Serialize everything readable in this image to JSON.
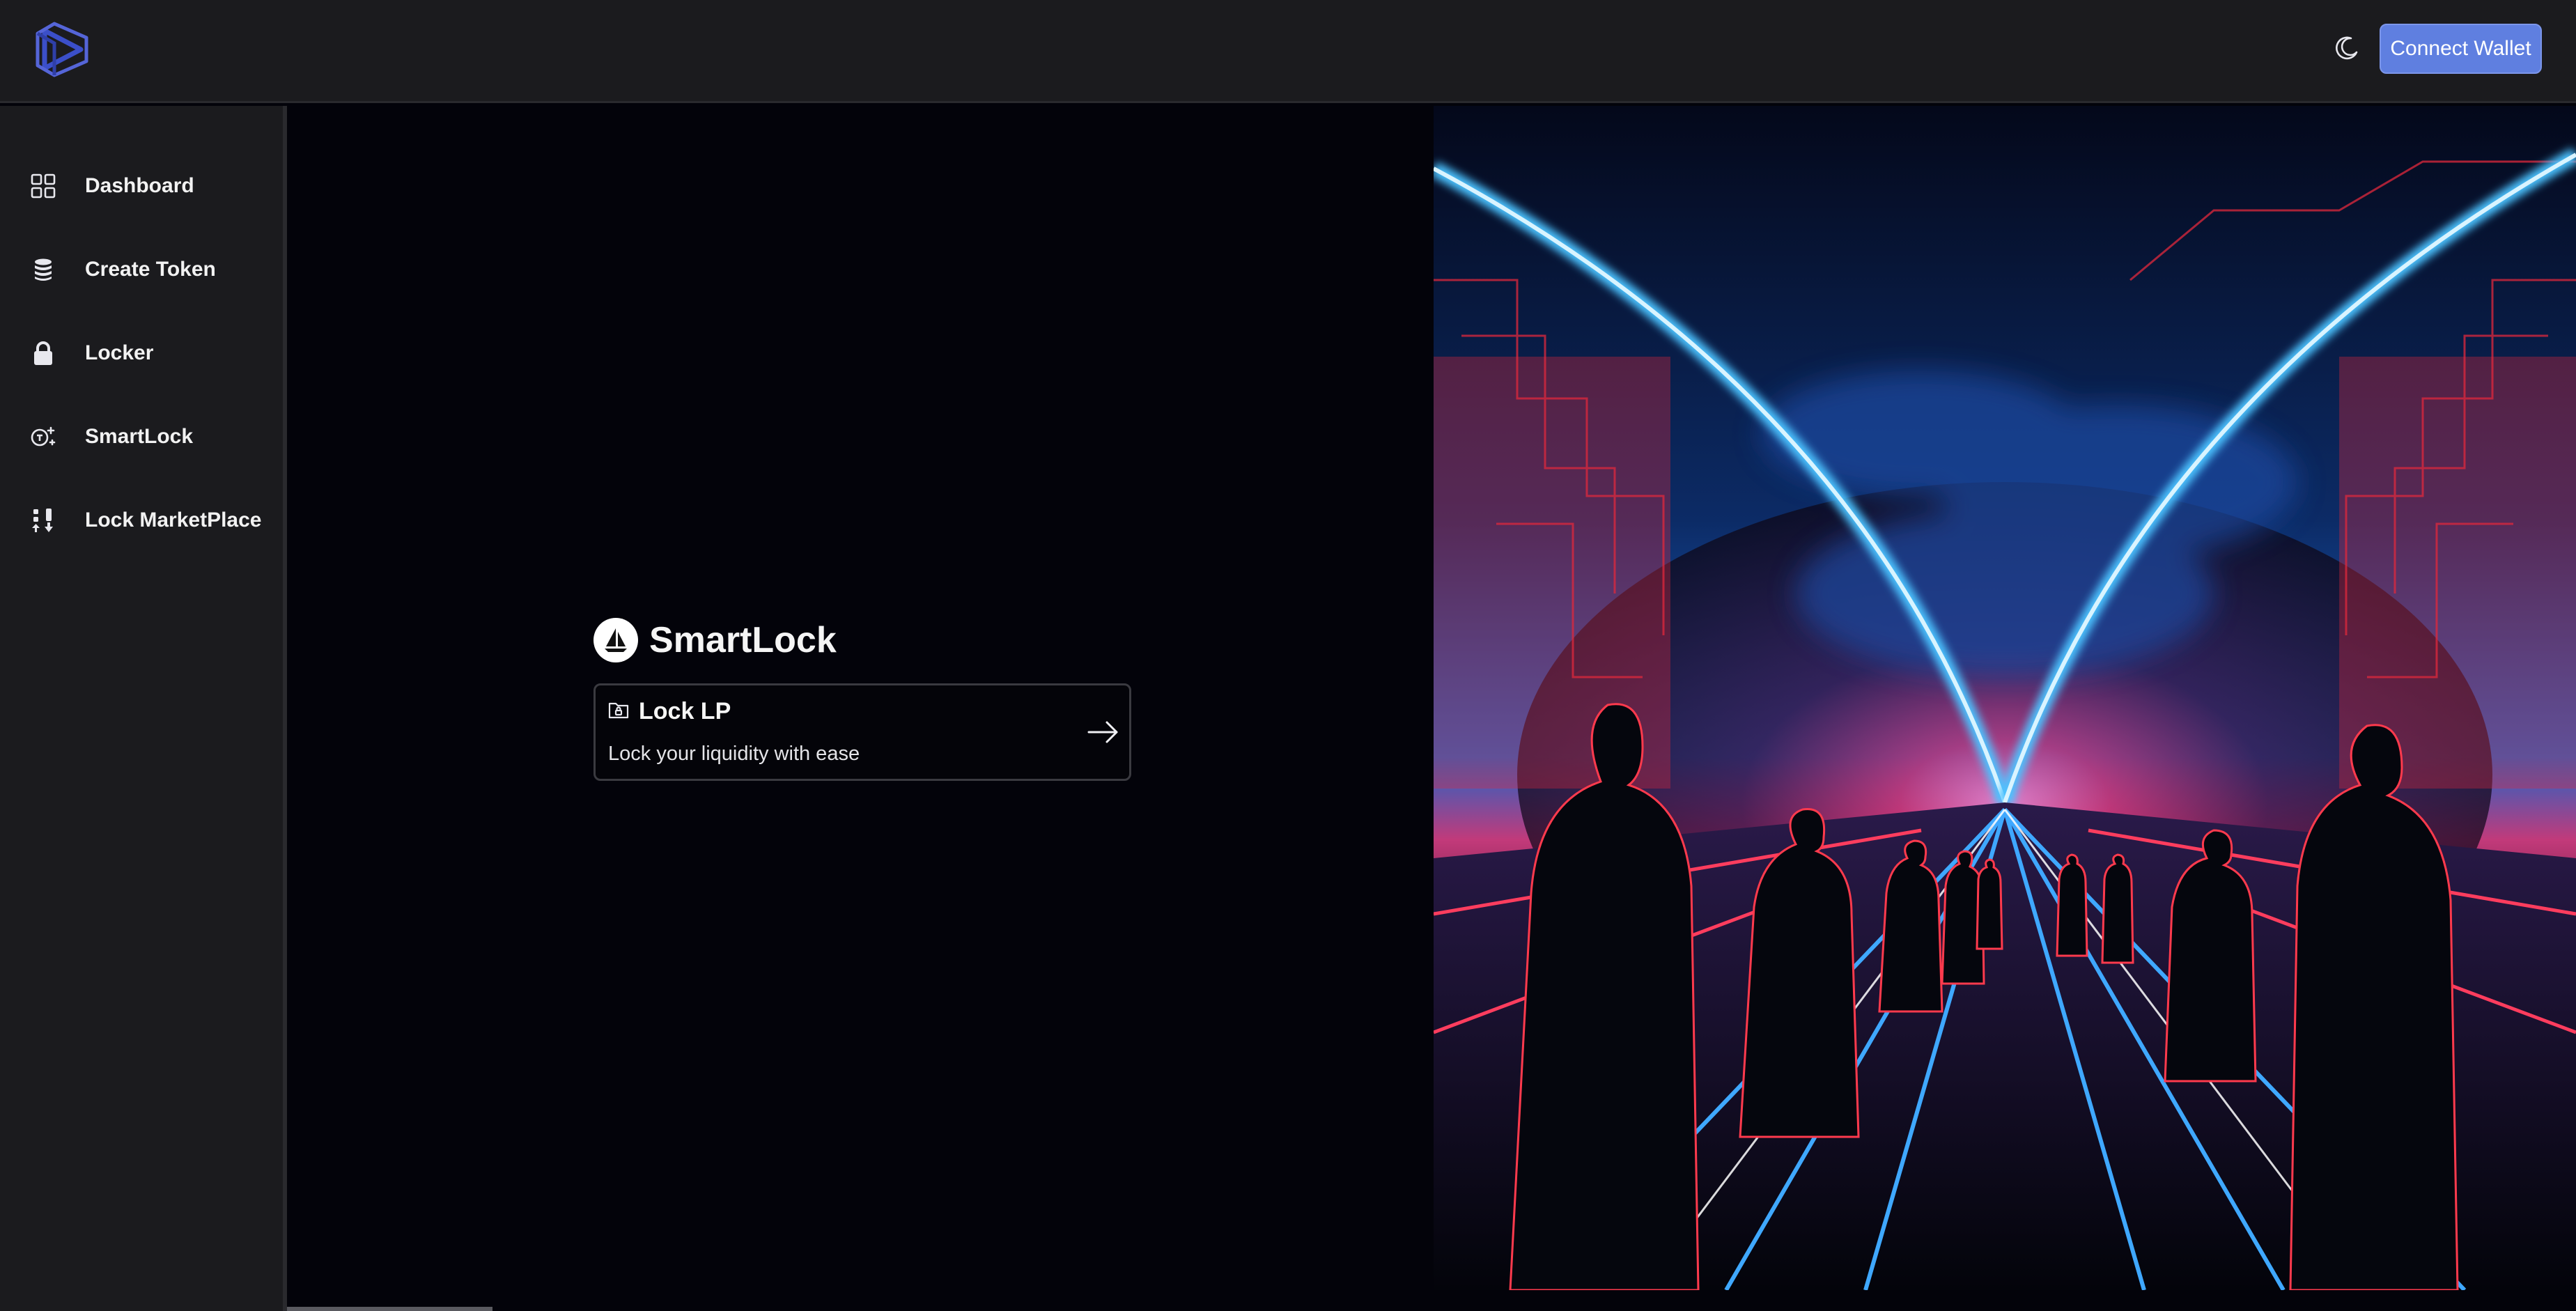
{
  "header": {
    "logo_icon": "hexagon-play-logo",
    "theme_toggle_icon": "moon-icon",
    "connect_label": "Connect Wallet",
    "accent_color": "#5f7fe0"
  },
  "sidebar": {
    "items": [
      {
        "label": "Dashboard",
        "icon": "grid-icon"
      },
      {
        "label": "Create Token",
        "icon": "coin-stack-icon"
      },
      {
        "label": "Locker",
        "icon": "lock-icon"
      },
      {
        "label": "SmartLock",
        "icon": "timer-spark-icon"
      },
      {
        "label": "Lock MarketPlace",
        "icon": "sort-arrows-icon"
      }
    ]
  },
  "main": {
    "brand_icon": "sailboat-icon",
    "brand_title": "SmartLock",
    "card": {
      "icon": "folder-lock-icon",
      "title": "Lock LP",
      "description": "Lock your liquidity with ease",
      "arrow_icon": "arrow-right-icon"
    },
    "hero_image": "neon-cyberpunk-figures-walking-artwork"
  }
}
